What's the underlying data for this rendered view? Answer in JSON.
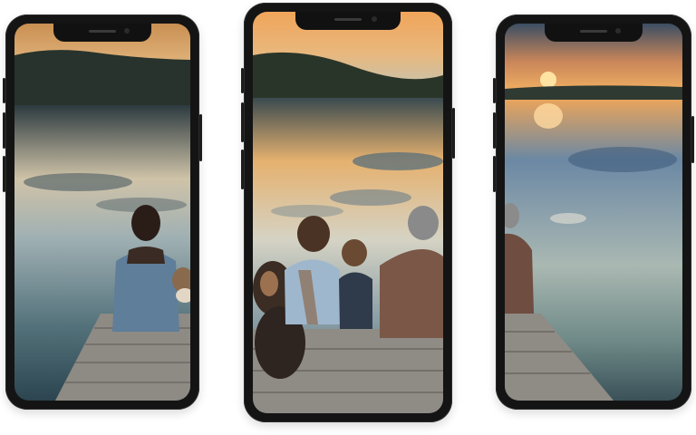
{
  "scene": {
    "description_free": true,
    "phones": [
      {
        "id": "left",
        "content": "woman-with-dog-on-dock"
      },
      {
        "id": "center",
        "content": "family-with-dog-on-dock"
      },
      {
        "id": "right",
        "content": "man-on-dock-at-sunset"
      }
    ],
    "colors": {
      "frame": "#141414",
      "sky_warm": "#f2a85a",
      "sky_cool": "#2f4a63",
      "water_light": "#cfd6cf",
      "water_dark": "#2a3b44",
      "dock_wood": "#8f8a84"
    }
  }
}
